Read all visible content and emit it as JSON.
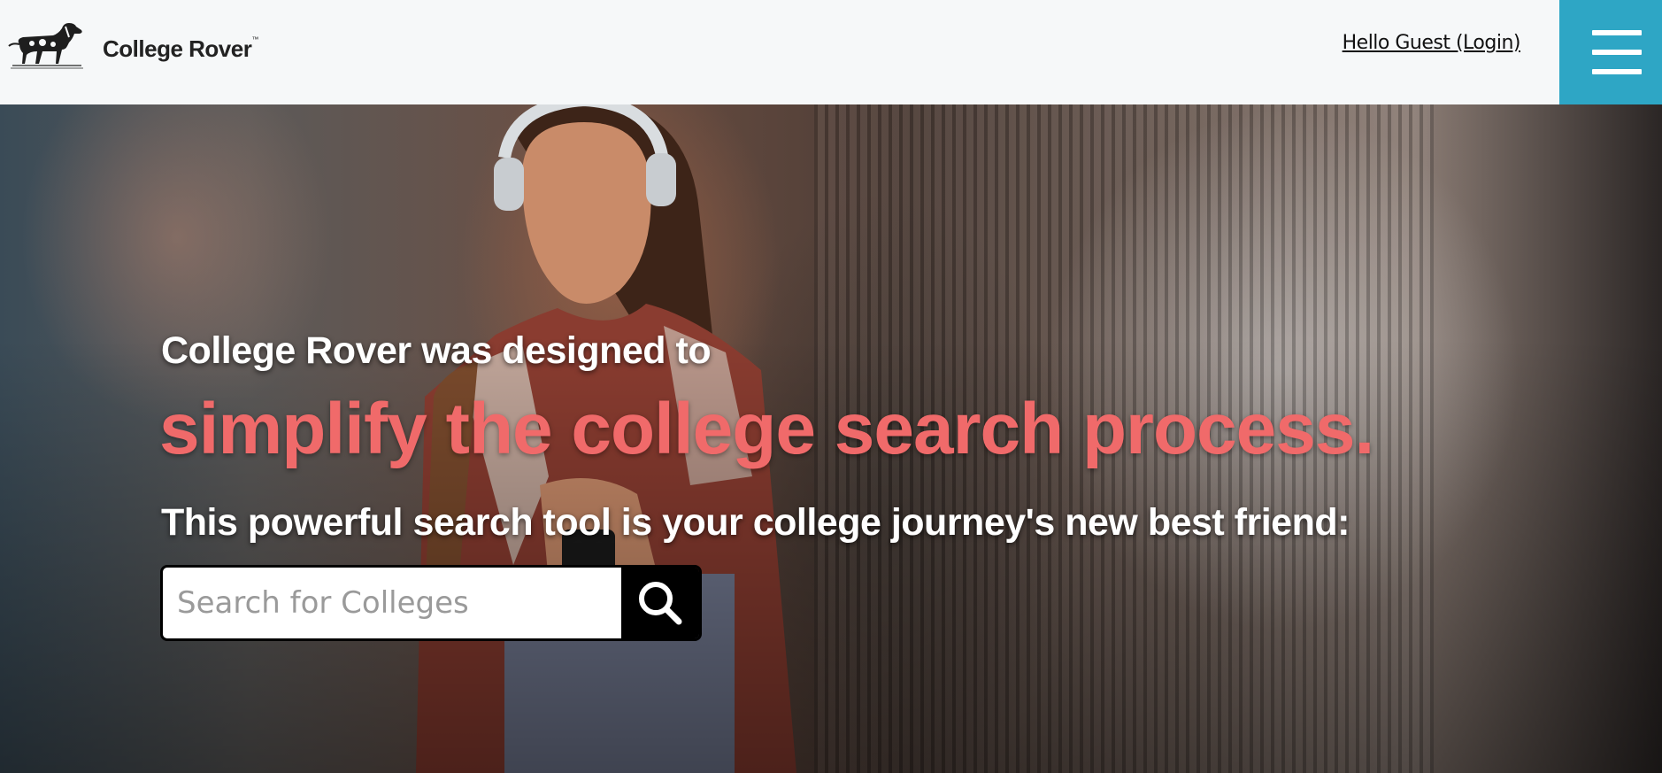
{
  "header": {
    "brand_name": "College Rover",
    "brand_mark": "™",
    "login_text": "Hello Guest (Login)",
    "menu_icon": "hamburger-icon",
    "menu_color": "#2ea6c5"
  },
  "hero": {
    "line_1": "College Rover was designed to",
    "line_2": "simplify the college search process.",
    "line_3": "This powerful search tool is your college journey's new best friend:",
    "accent_color": "#f06a6a"
  },
  "search": {
    "placeholder": "Search for Colleges",
    "value": "",
    "button_icon": "search-icon"
  }
}
